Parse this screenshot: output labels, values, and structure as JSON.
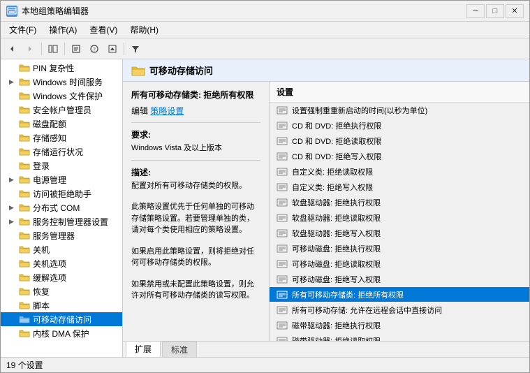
{
  "window": {
    "title": "本地组策略编辑器",
    "icon": "📋"
  },
  "titlebar_buttons": {
    "minimize": "─",
    "maximize": "□",
    "close": "✕"
  },
  "menubar": {
    "items": [
      {
        "id": "file",
        "label": "文件(F)"
      },
      {
        "id": "action",
        "label": "操作(A)"
      },
      {
        "id": "view",
        "label": "查看(V)"
      },
      {
        "id": "help",
        "label": "帮助(H)"
      }
    ]
  },
  "toolbar": {
    "back_label": "◄",
    "forward_label": "►",
    "up_label": "↑",
    "show_hide_label": "▤",
    "copy_label": "⧉",
    "filter_label": "▽"
  },
  "tree": {
    "items": [
      {
        "id": "pin",
        "label": "PIN 复杂性",
        "indent": 1,
        "expandable": false,
        "selected": false
      },
      {
        "id": "windows-time",
        "label": "Windows 时间服务",
        "indent": 1,
        "expandable": true,
        "selected": false
      },
      {
        "id": "windows-file",
        "label": "Windows 文件保护",
        "indent": 1,
        "expandable": false,
        "selected": false
      },
      {
        "id": "account-mgr",
        "label": "安全帐户管理员",
        "indent": 1,
        "expandable": false,
        "selected": false
      },
      {
        "id": "disk-quota",
        "label": "磁盘配额",
        "indent": 1,
        "expandable": false,
        "selected": false
      },
      {
        "id": "storage-aware",
        "label": "存储感知",
        "indent": 1,
        "expandable": false,
        "selected": false
      },
      {
        "id": "storage-status",
        "label": "存储运行状况",
        "indent": 1,
        "expandable": false,
        "selected": false
      },
      {
        "id": "login",
        "label": "登录",
        "indent": 1,
        "expandable": false,
        "selected": false
      },
      {
        "id": "power-mgmt",
        "label": "电源管理",
        "indent": 1,
        "expandable": true,
        "selected": false
      },
      {
        "id": "access-denied",
        "label": "访问被拒绝助手",
        "indent": 1,
        "expandable": false,
        "selected": false
      },
      {
        "id": "distributed-com",
        "label": "分布式 COM",
        "indent": 1,
        "expandable": true,
        "selected": false
      },
      {
        "id": "service-ctrl",
        "label": "服务控制管理器设置",
        "indent": 1,
        "expandable": true,
        "selected": false
      },
      {
        "id": "service-mgr",
        "label": "服务管理器",
        "indent": 1,
        "expandable": false,
        "selected": false
      },
      {
        "id": "shutdown",
        "label": "关机",
        "indent": 1,
        "expandable": false,
        "selected": false
      },
      {
        "id": "shutdown-opts",
        "label": "关机选项",
        "indent": 1,
        "expandable": false,
        "selected": false
      },
      {
        "id": "cache-opts",
        "label": "缓解选项",
        "indent": 1,
        "expandable": false,
        "selected": false
      },
      {
        "id": "recovery",
        "label": "恢复",
        "indent": 1,
        "expandable": false,
        "selected": false
      },
      {
        "id": "scripts",
        "label": "脚本",
        "indent": 1,
        "expandable": false,
        "selected": false
      },
      {
        "id": "removable-storage",
        "label": "可移动存储访问",
        "indent": 1,
        "expandable": false,
        "selected": true
      },
      {
        "id": "kernel-dma",
        "label": "内核 DMA 保护",
        "indent": 1,
        "expandable": false,
        "selected": false
      }
    ]
  },
  "right_header": {
    "title": "可移动存储访问"
  },
  "description": {
    "policy_title": "所有可移动存储类: 拒绝所有权限",
    "edit_label": "编辑",
    "link_label": "策略设置",
    "requirements_title": "要求:",
    "requirements_text": "Windows Vista 及以上版本",
    "description_title": "描述:",
    "description_text1": "配置对所有可移动存储类的权限。",
    "description_text2": "此策略设置优先于任何单独的可移动存储策略设置。若要管理单独的类，请对每个类使用相应的策略设置。",
    "description_text3": "如果启用此策略设置，则将拒绝对任何可移动存储类的权限。",
    "description_text4": "如果禁用或未配置此策略设置，则允许对所有可移动存储类的读写权限。"
  },
  "settings": {
    "header": "设置",
    "items": [
      {
        "id": "set-restart-time",
        "label": "设置强制重重新启动的时间(以秒为单位)",
        "selected": false
      },
      {
        "id": "cd-dvd-exec",
        "label": "CD 和 DVD: 拒绝执行权限",
        "selected": false
      },
      {
        "id": "cd-dvd-read",
        "label": "CD 和 DVD: 拒绝读取权限",
        "selected": false
      },
      {
        "id": "cd-dvd-write",
        "label": "CD 和 DVD: 拒绝写入权限",
        "selected": false
      },
      {
        "id": "custom-read",
        "label": "自定义类: 拒绝读取权限",
        "selected": false
      },
      {
        "id": "custom-write",
        "label": "自定义类: 拒绝写入权限",
        "selected": false
      },
      {
        "id": "floppy-exec",
        "label": "软盘驱动器: 拒绝执行权限",
        "selected": false
      },
      {
        "id": "floppy-read",
        "label": "软盘驱动器: 拒绝读取权限",
        "selected": false
      },
      {
        "id": "floppy-write",
        "label": "软盘驱动器: 拒绝写入权限",
        "selected": false
      },
      {
        "id": "removable-exec",
        "label": "可移动磁盘: 拒绝执行权限",
        "selected": false
      },
      {
        "id": "removable-read",
        "label": "可移动磁盘: 拒绝读取权限",
        "selected": false
      },
      {
        "id": "removable-write",
        "label": "可移动磁盘: 拒绝写入权限",
        "selected": false
      },
      {
        "id": "all-removable-deny",
        "label": "所有可移动存储类: 拒绝所有权限",
        "selected": true
      },
      {
        "id": "all-removable-remote",
        "label": "所有可移动存储: 允许在远程会话中直接访问",
        "selected": false
      },
      {
        "id": "tape-exec",
        "label": "磁带驱动器: 拒绝执行权限",
        "selected": false
      },
      {
        "id": "tape-read",
        "label": "磁带驱动器: 拒绝读取权限",
        "selected": false
      }
    ]
  },
  "tabs": {
    "items": [
      {
        "id": "expand",
        "label": "扩展",
        "active": true
      },
      {
        "id": "standard",
        "label": "标准",
        "active": false
      }
    ]
  },
  "statusbar": {
    "text": "19 个设置"
  },
  "colors": {
    "selected_bg": "#0078d7",
    "header_bg": "#e8f0fb",
    "link": "#0078d7"
  }
}
